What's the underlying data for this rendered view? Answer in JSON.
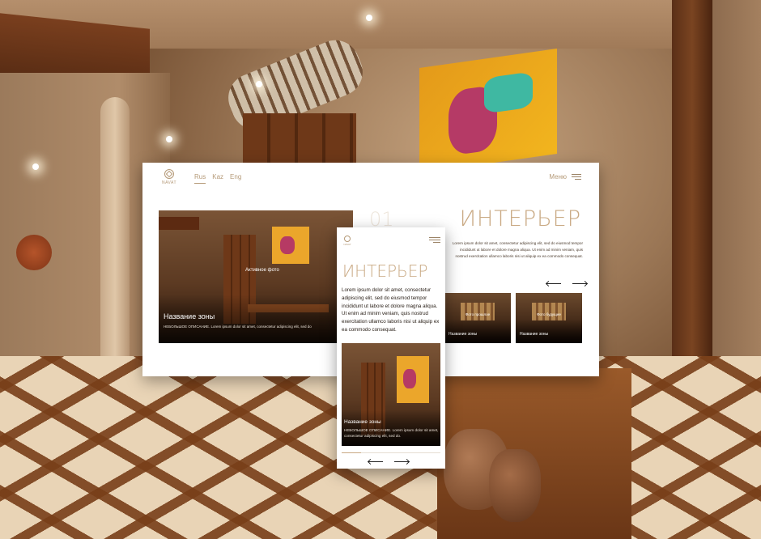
{
  "desktop": {
    "logo_text": "NAVAT",
    "langs": [
      "Rus",
      "Kaz",
      "Eng"
    ],
    "active_lang": "Rus",
    "menu_label": "Меню",
    "hero": {
      "active_photo_label": "Активное фото",
      "zone_title": "Название зоны",
      "zone_desc": "НЕБОЛЬШОЕ ОПИСАНИЕ. Lorem ipsum dolor sit amet, consectetur adipiscing elit, sed do"
    },
    "slide_number": "01",
    "section_title": "ИНТЕРЬЕР",
    "lead": "Lorem ipsum dolor sit amet, consectetur adipiscing elit, sed do eiusmod tempor incididunt ut labore et dolore magna aliqua. Ut enim ad minim veniam, quis nostrud exercitation ullamco laboris nisi ut aliquip ex ea commodo consequat.",
    "thumbs": [
      {
        "top_label": "Фото прошлое",
        "label": "Название зоны"
      },
      {
        "top_label": "Фото будущее",
        "label": "Название зоны"
      }
    ]
  },
  "mobile": {
    "logo_text": "NAVAT",
    "section_title": "ИНТЕРЬЕР",
    "lead": "Lorem ipsum dolor sit amet, consectetur adipiscing elit, sed do eiusmod tempor incididunt ut labore et dolore magna aliqua. Ut enim ad minim veniam, quis nostrud exercitation ullamco laboris nisi ut aliquip ex ea commodo consequat.",
    "zone_title": "Название зоны",
    "zone_desc": "НЕБОЛЬШОЕ ОПИСАНИЕ. Lorem ipsum dolor sit amet, consectetur adipiscing elit, sed do.",
    "progress": 0.2
  },
  "colors": {
    "accent_gold": "#c9a983",
    "logo_gold": "#b59a78",
    "text_dark": "#2a2018"
  },
  "icons": {
    "menu": "burger-menu-icon",
    "prev": "arrow-left-icon",
    "next": "arrow-right-icon",
    "logo": "navat-logo-icon"
  }
}
